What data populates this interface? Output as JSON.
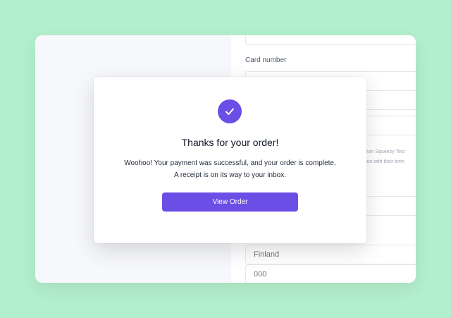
{
  "form": {
    "card_number_label": "Card number",
    "legal_line_1": "emon Squeezy Test",
    "legal_line_2": "ance with their term",
    "country_value": "Finland",
    "postal_value": "000"
  },
  "modal": {
    "title": "Thanks for your order!",
    "message_line_1": "Woohoo! Your payment was successful, and your order is complete.",
    "message_line_2": "A receipt is on its way to your inbox.",
    "button_label": "View Order",
    "check_icon": "check-icon"
  },
  "colors": {
    "background": "#b3efcc",
    "accent": "#6b4ee6"
  }
}
